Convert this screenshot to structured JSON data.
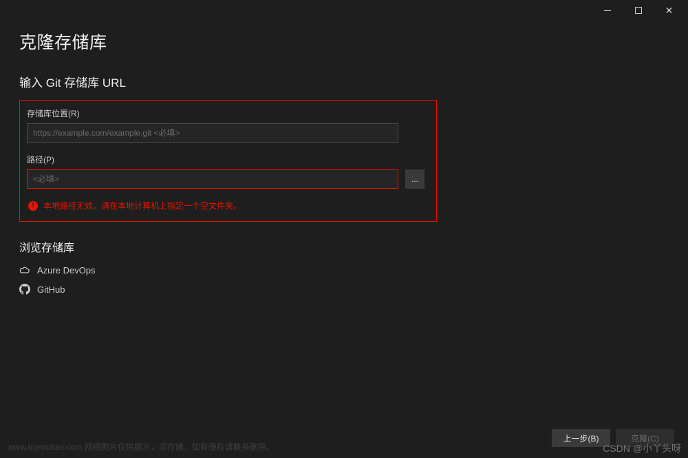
{
  "titlebar": {
    "minimize_label": "−",
    "maximize_label": "◻",
    "close_label": "✕"
  },
  "dialog": {
    "title": "克隆存储库",
    "url_section_title": "输入 Git 存储库 URL",
    "repo_location": {
      "label": "存储库位置(R)",
      "placeholder": "https://example.com/example.git <必填>"
    },
    "path": {
      "label": "路径(P)",
      "placeholder": "<必填>",
      "browse_label": "..."
    },
    "error_message": "本地路径无效。请在本地计算机上指定一个空文件夹。",
    "browse_section_title": "浏览存储库",
    "repos": [
      {
        "name": "Azure DevOps",
        "icon": "cloud"
      },
      {
        "name": "GitHub",
        "icon": "github"
      }
    ]
  },
  "footer": {
    "back_label": "上一步(B)",
    "clone_label": "克隆(C)"
  },
  "watermark": {
    "left": "www.toymoban.com 网络图片仅供展示，非存储。如有侵权请联系删除。",
    "right": "CSDN @小丫头呀"
  },
  "colors": {
    "error": "#e51400",
    "background": "#1e1e1e"
  }
}
